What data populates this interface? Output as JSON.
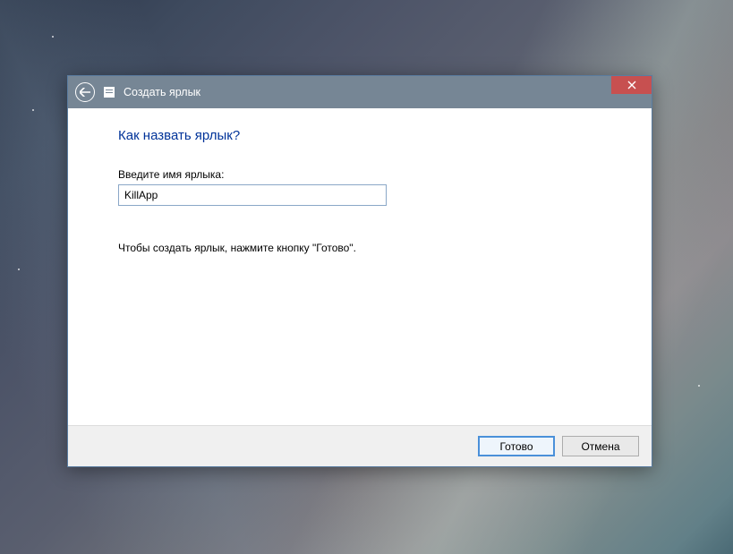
{
  "titlebar": {
    "title": "Создать ярлык"
  },
  "content": {
    "heading": "Как назвать ярлык?",
    "field_label": "Введите имя ярлыка:",
    "input_value": "KillApp",
    "instruction": "Чтобы создать ярлык, нажмите кнопку \"Готово\"."
  },
  "footer": {
    "primary": "Готово",
    "cancel": "Отмена"
  }
}
